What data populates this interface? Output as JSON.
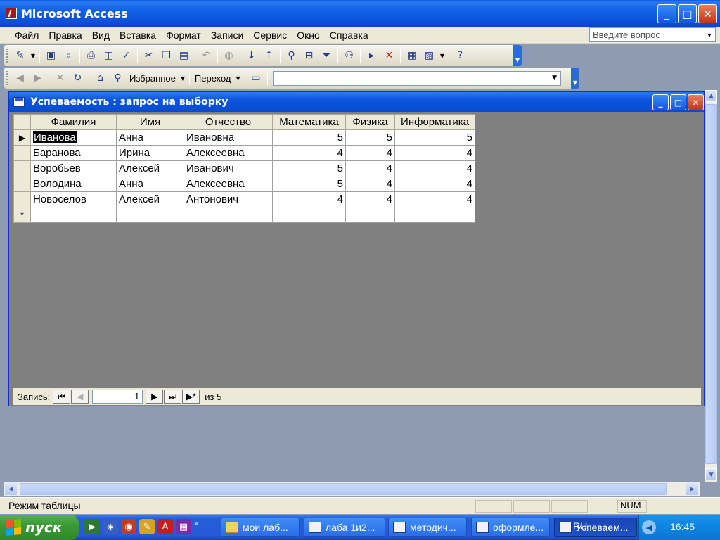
{
  "app": {
    "title": "Microsoft Access",
    "minimize": "_",
    "maximize": "□",
    "close": "✕"
  },
  "menu": {
    "items": [
      "Файл",
      "Правка",
      "Вид",
      "Вставка",
      "Формат",
      "Записи",
      "Сервис",
      "Окно",
      "Справка"
    ],
    "help_placeholder": "Введите вопрос"
  },
  "toolbar2": {
    "favorites": "Избранное",
    "goto": "Переход"
  },
  "child": {
    "title": "Успеваемость : запрос на выборку"
  },
  "datasheet": {
    "columns": [
      "Фамилия",
      "Имя",
      "Отчество",
      "Математика",
      "Физика",
      "Информатика"
    ],
    "rows": [
      [
        "Иванова",
        "Анна",
        "Ивановна",
        "5",
        "5",
        "5"
      ],
      [
        "Баранова",
        "Ирина",
        "Алексеевна",
        "4",
        "4",
        "4"
      ],
      [
        "Воробьев",
        "Алексей",
        "Иванович",
        "5",
        "4",
        "4"
      ],
      [
        "Володина",
        "Анна",
        "Алексеевна",
        "5",
        "4",
        "4"
      ],
      [
        "Новоселов",
        "Алексей",
        "Антонович",
        "4",
        "4",
        "4"
      ]
    ],
    "new_row_marker": "*",
    "current_row_marker": "▶"
  },
  "recnav": {
    "label": "Запись:",
    "current": "1",
    "of_label": "из 5"
  },
  "status": {
    "mode": "Режим таблицы",
    "num": "NUM"
  },
  "taskbar": {
    "start": "пуск",
    "tasks": [
      "мои лаб...",
      "лаба 1и2...",
      "методич...",
      "оформле...",
      "Успеваем..."
    ],
    "lang": "RU",
    "clock": "16:45"
  },
  "colors": {
    "title_blue": "#0b55de",
    "workspace_gray": "#808080",
    "face": "#ece9d8",
    "start_green": "#3c9a36"
  }
}
